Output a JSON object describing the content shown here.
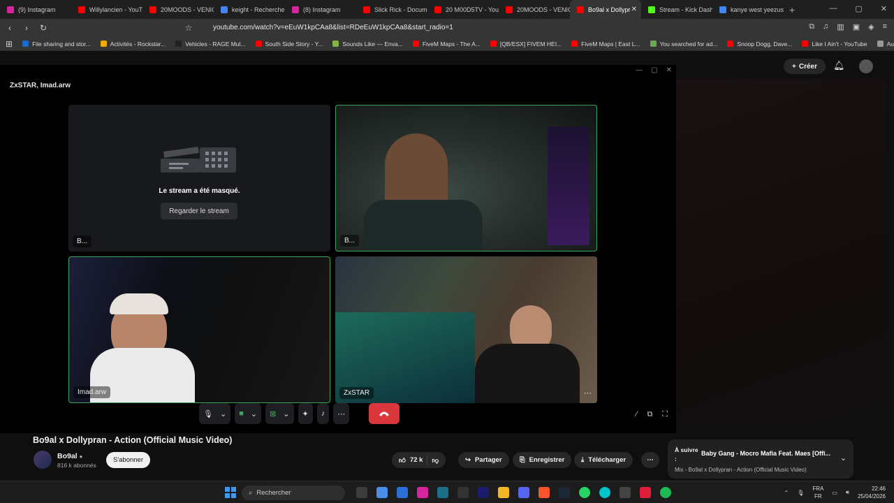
{
  "browser": {
    "tabs": [
      {
        "label": "(9) Instagram",
        "color": "#d6249f"
      },
      {
        "label": "Willylancien - YouTu",
        "color": "#ff0000"
      },
      {
        "label": "20MOODS - VENIC",
        "color": "#ff0000"
      },
      {
        "label": "keight - Recherche",
        "color": "#4285f4"
      },
      {
        "label": "(8) Instagram",
        "color": "#d6249f"
      },
      {
        "label": "Slick Rick - Docume",
        "color": "#ff0000"
      },
      {
        "label": "20 M00D5TV - YouT",
        "color": "#ff0000"
      },
      {
        "label": "20MOODS - VENIC",
        "color": "#ff0000"
      },
      {
        "label": "Bo9al x Dollypr",
        "color": "#ff0000",
        "active": true
      },
      {
        "label": "Stream - Kick Dashb",
        "color": "#53fc18"
      },
      {
        "label": "kanye west yeezus",
        "color": "#4285f4"
      }
    ],
    "url": "youtube.com/watch?v=eEuW1kpCAa8&list=RDeEuW1kpCAa8&start_radio=1",
    "bookmarks": [
      {
        "label": "File sharing and stor...",
        "color": "#1b6ac9"
      },
      {
        "label": "Activités - Rockstar...",
        "color": "#f2a900"
      },
      {
        "label": "Vehicles - RAGE Mul...",
        "color": "#222222"
      },
      {
        "label": "South Side Story - Y...",
        "color": "#ff0000"
      },
      {
        "label": "Sounds Like — Enva...",
        "color": "#81b441"
      },
      {
        "label": "FiveM Maps - The A...",
        "color": "#ff0000"
      },
      {
        "label": "[QB/ESX] FIVEM HEI...",
        "color": "#ff0000"
      },
      {
        "label": "FiveM Maps | East L...",
        "color": "#ff0000"
      },
      {
        "label": "You searched for ad...",
        "color": "#6aa84f"
      },
      {
        "label": "Snoop Dogg, Dave...",
        "color": "#ff0000"
      },
      {
        "label": "Like I Ain't - YouTube",
        "color": "#ff0000"
      },
      {
        "label": "Autres favoris",
        "color": "#999999"
      }
    ]
  },
  "youtube": {
    "create_label": "Créer",
    "video_title": "Bo9al x Dollypran - Action (Official Music Video)",
    "channel_name": "Bo9al",
    "channel_subs": "816 k abonnés",
    "subscribe_label": "S'abonner",
    "likes": "72 k",
    "share_label": "Partager",
    "save_label": "Enregistrer",
    "download_label": "Télécharger",
    "up_next_label": "À suivre :",
    "up_next_song": "Baby Gang - Mocro Mafia Feat. Maes [Offi...",
    "up_next_mix": "Mix - Bo9al x Dollypran - Action (Official Music Video)"
  },
  "call": {
    "title": "ZxSTAR, Imad.arw",
    "masked_message": "Le stream a été masqué.",
    "watch_stream_label": "Regarder le stream",
    "tiles": [
      {
        "label": "B..."
      },
      {
        "label": "B..."
      },
      {
        "label": "Imad.arw"
      },
      {
        "label": "ZxSTAR"
      }
    ]
  },
  "taskbar": {
    "search_label": "Rechercher",
    "lang_top": "FRA",
    "lang_bottom": "FR",
    "time": "22:46",
    "date": "25/04/2026"
  }
}
